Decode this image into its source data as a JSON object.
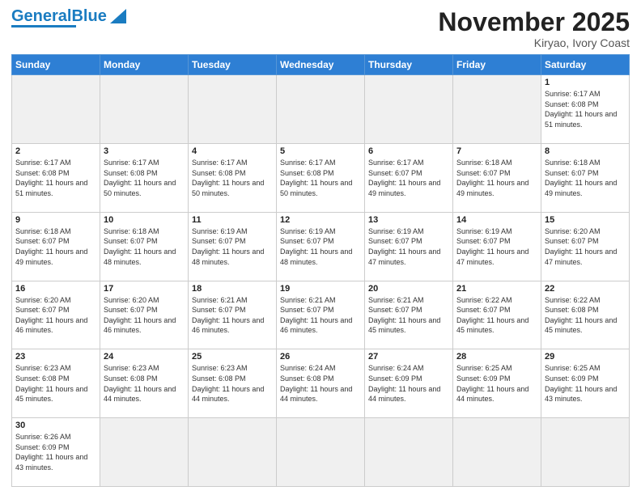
{
  "header": {
    "logo_general": "General",
    "logo_blue": "Blue",
    "month_title": "November 2025",
    "location": "Kiryao, Ivory Coast"
  },
  "days_of_week": [
    "Sunday",
    "Monday",
    "Tuesday",
    "Wednesday",
    "Thursday",
    "Friday",
    "Saturday"
  ],
  "weeks": [
    [
      {
        "day": "",
        "empty": true
      },
      {
        "day": "",
        "empty": true
      },
      {
        "day": "",
        "empty": true
      },
      {
        "day": "",
        "empty": true
      },
      {
        "day": "",
        "empty": true
      },
      {
        "day": "",
        "empty": true
      },
      {
        "day": "1",
        "sunrise": "6:17 AM",
        "sunset": "6:08 PM",
        "daylight": "11 hours and 51 minutes."
      }
    ],
    [
      {
        "day": "2",
        "sunrise": "6:17 AM",
        "sunset": "6:08 PM",
        "daylight": "11 hours and 51 minutes."
      },
      {
        "day": "3",
        "sunrise": "6:17 AM",
        "sunset": "6:08 PM",
        "daylight": "11 hours and 50 minutes."
      },
      {
        "day": "4",
        "sunrise": "6:17 AM",
        "sunset": "6:08 PM",
        "daylight": "11 hours and 50 minutes."
      },
      {
        "day": "5",
        "sunrise": "6:17 AM",
        "sunset": "6:08 PM",
        "daylight": "11 hours and 50 minutes."
      },
      {
        "day": "6",
        "sunrise": "6:17 AM",
        "sunset": "6:07 PM",
        "daylight": "11 hours and 49 minutes."
      },
      {
        "day": "7",
        "sunrise": "6:18 AM",
        "sunset": "6:07 PM",
        "daylight": "11 hours and 49 minutes."
      },
      {
        "day": "8",
        "sunrise": "6:18 AM",
        "sunset": "6:07 PM",
        "daylight": "11 hours and 49 minutes."
      }
    ],
    [
      {
        "day": "9",
        "sunrise": "6:18 AM",
        "sunset": "6:07 PM",
        "daylight": "11 hours and 49 minutes."
      },
      {
        "day": "10",
        "sunrise": "6:18 AM",
        "sunset": "6:07 PM",
        "daylight": "11 hours and 48 minutes."
      },
      {
        "day": "11",
        "sunrise": "6:19 AM",
        "sunset": "6:07 PM",
        "daylight": "11 hours and 48 minutes."
      },
      {
        "day": "12",
        "sunrise": "6:19 AM",
        "sunset": "6:07 PM",
        "daylight": "11 hours and 48 minutes."
      },
      {
        "day": "13",
        "sunrise": "6:19 AM",
        "sunset": "6:07 PM",
        "daylight": "11 hours and 47 minutes."
      },
      {
        "day": "14",
        "sunrise": "6:19 AM",
        "sunset": "6:07 PM",
        "daylight": "11 hours and 47 minutes."
      },
      {
        "day": "15",
        "sunrise": "6:20 AM",
        "sunset": "6:07 PM",
        "daylight": "11 hours and 47 minutes."
      }
    ],
    [
      {
        "day": "16",
        "sunrise": "6:20 AM",
        "sunset": "6:07 PM",
        "daylight": "11 hours and 46 minutes."
      },
      {
        "day": "17",
        "sunrise": "6:20 AM",
        "sunset": "6:07 PM",
        "daylight": "11 hours and 46 minutes."
      },
      {
        "day": "18",
        "sunrise": "6:21 AM",
        "sunset": "6:07 PM",
        "daylight": "11 hours and 46 minutes."
      },
      {
        "day": "19",
        "sunrise": "6:21 AM",
        "sunset": "6:07 PM",
        "daylight": "11 hours and 46 minutes."
      },
      {
        "day": "20",
        "sunrise": "6:21 AM",
        "sunset": "6:07 PM",
        "daylight": "11 hours and 45 minutes."
      },
      {
        "day": "21",
        "sunrise": "6:22 AM",
        "sunset": "6:07 PM",
        "daylight": "11 hours and 45 minutes."
      },
      {
        "day": "22",
        "sunrise": "6:22 AM",
        "sunset": "6:08 PM",
        "daylight": "11 hours and 45 minutes."
      }
    ],
    [
      {
        "day": "23",
        "sunrise": "6:23 AM",
        "sunset": "6:08 PM",
        "daylight": "11 hours and 45 minutes."
      },
      {
        "day": "24",
        "sunrise": "6:23 AM",
        "sunset": "6:08 PM",
        "daylight": "11 hours and 44 minutes."
      },
      {
        "day": "25",
        "sunrise": "6:23 AM",
        "sunset": "6:08 PM",
        "daylight": "11 hours and 44 minutes."
      },
      {
        "day": "26",
        "sunrise": "6:24 AM",
        "sunset": "6:08 PM",
        "daylight": "11 hours and 44 minutes."
      },
      {
        "day": "27",
        "sunrise": "6:24 AM",
        "sunset": "6:09 PM",
        "daylight": "11 hours and 44 minutes."
      },
      {
        "day": "28",
        "sunrise": "6:25 AM",
        "sunset": "6:09 PM",
        "daylight": "11 hours and 44 minutes."
      },
      {
        "day": "29",
        "sunrise": "6:25 AM",
        "sunset": "6:09 PM",
        "daylight": "11 hours and 43 minutes."
      }
    ],
    [
      {
        "day": "30",
        "sunrise": "6:26 AM",
        "sunset": "6:09 PM",
        "daylight": "11 hours and 43 minutes."
      },
      {
        "day": "",
        "empty": true
      },
      {
        "day": "",
        "empty": true
      },
      {
        "day": "",
        "empty": true
      },
      {
        "day": "",
        "empty": true
      },
      {
        "day": "",
        "empty": true
      },
      {
        "day": "",
        "empty": true
      }
    ]
  ]
}
